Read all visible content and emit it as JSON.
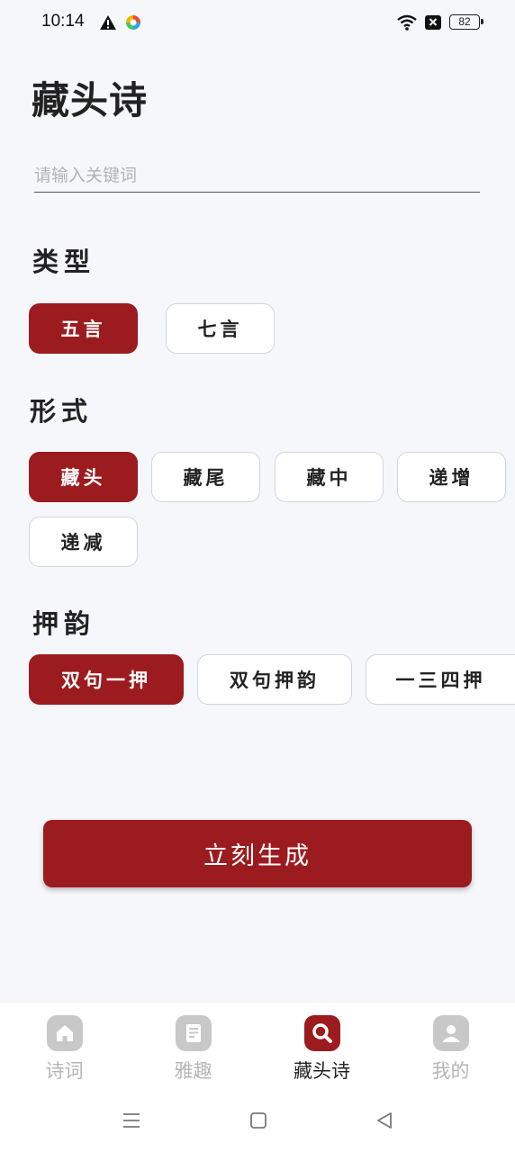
{
  "status_bar": {
    "time": "10:14",
    "battery": "82"
  },
  "page": {
    "title": "藏头诗"
  },
  "keyword": {
    "placeholder": "请输入关键词",
    "value": ""
  },
  "type_section": {
    "label": "类型",
    "options": [
      "五言",
      "七言"
    ],
    "selected": "五言"
  },
  "form_section": {
    "label": "形式",
    "options": [
      "藏头",
      "藏尾",
      "藏中",
      "递增",
      "递减"
    ],
    "selected": "藏头"
  },
  "rhyme_section": {
    "label": "押韵",
    "options": [
      "双句一押",
      "双句押韵",
      "一三四押"
    ],
    "selected": "双句一押"
  },
  "generate_button": {
    "label": "立刻生成"
  },
  "bottom_nav": {
    "items": [
      {
        "label": "诗词",
        "icon": "home-icon"
      },
      {
        "label": "雅趣",
        "icon": "document-icon"
      },
      {
        "label": "藏头诗",
        "icon": "search-icon"
      },
      {
        "label": "我的",
        "icon": "user-icon"
      }
    ],
    "active": "藏头诗"
  },
  "colors": {
    "accent": "#9c1b1f",
    "background": "#f6f7fb",
    "inactive_icon": "#c8c8c8",
    "inactive_text": "#b5b5b5"
  }
}
